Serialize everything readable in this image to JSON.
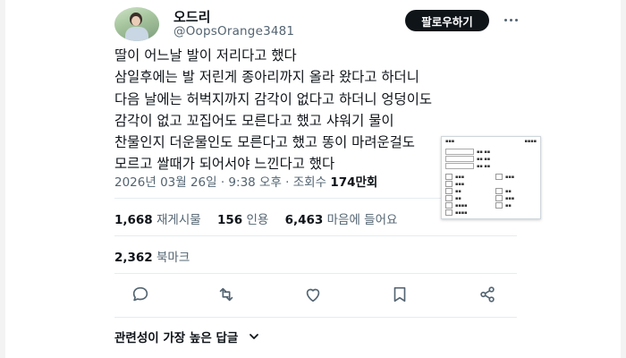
{
  "author": {
    "display_name": "오드리",
    "handle": "@OopsOrange3481",
    "follow_label": "팔로우하기"
  },
  "tweet": {
    "lines": [
      "딸이 어느날 발이 저리다고 했다",
      "삼일후에는 발 저린게 종아리까지 올라 왔다고 하더니",
      "다음 날에는 허벅지까지 감각이 없다고 하더니 엉덩이도",
      "감각이 없고 꼬집어도 모른다고 했고 샤워기 물이",
      "찬물인지 더운물인도 모른다고 했고 똥이 마려운걸도",
      "모르고 쌀때가 되어서야 느낀다고 했다"
    ],
    "timestamp": "2026년 03월 26일 · 9:38 오후 · 조회수",
    "views": "174만회"
  },
  "stats": {
    "retweets_count": "1,668",
    "retweets_label": "재게시물",
    "quotes_count": "156",
    "quotes_label": "인용",
    "likes_count": "6,463",
    "likes_label": "마음에 들어요",
    "bookmarks_count": "2,362",
    "bookmarks_label": "북마크"
  },
  "actions": [
    "reply-icon",
    "retweet-icon",
    "like-icon",
    "bookmark-icon",
    "share-icon"
  ],
  "replies": {
    "sort_label": "관련성이 가장 높은 답글"
  },
  "colors": {
    "text": "#0f1419",
    "secondary": "#536471",
    "divider": "#e6ecf0",
    "button": "#0f1419"
  }
}
